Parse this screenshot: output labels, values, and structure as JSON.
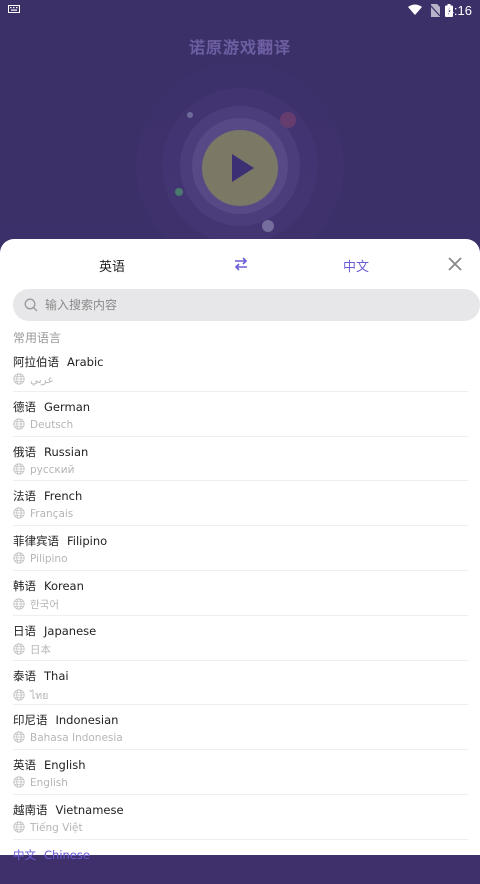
{
  "app": {
    "title": "诺原游戏翻译"
  },
  "status_bar": {
    "time": "4:16"
  },
  "lang_bar": {
    "source": "英语",
    "target": "中文"
  },
  "search": {
    "placeholder": "输入搜索内容"
  },
  "section": {
    "title": "常用语言"
  },
  "languages": [
    {
      "cn": "阿拉伯语",
      "en": "Arabic",
      "native": "عربي"
    },
    {
      "cn": "德语",
      "en": "German",
      "native": "Deutsch"
    },
    {
      "cn": "俄语",
      "en": "Russian",
      "native": "русский"
    },
    {
      "cn": "法语",
      "en": "French",
      "native": "Français"
    },
    {
      "cn": "菲律宾语",
      "en": "Filipino",
      "native": "Pilipino"
    },
    {
      "cn": "韩语",
      "en": "Korean",
      "native": "한국어"
    },
    {
      "cn": "日语",
      "en": "Japanese",
      "native": "日本"
    },
    {
      "cn": "泰语",
      "en": "Thai",
      "native": "ไทย"
    },
    {
      "cn": "印尼语",
      "en": "Indonesian",
      "native": "Bahasa Indonesia"
    },
    {
      "cn": "英语",
      "en": "English",
      "native": "English"
    },
    {
      "cn": "越南语",
      "en": "Vietnamese",
      "native": "Tiếng Việt"
    },
    {
      "cn": "中文",
      "en": "Chinese",
      "native": ""
    }
  ],
  "colors": {
    "accent": "#6b5fd8",
    "background": "#3e2f70"
  }
}
